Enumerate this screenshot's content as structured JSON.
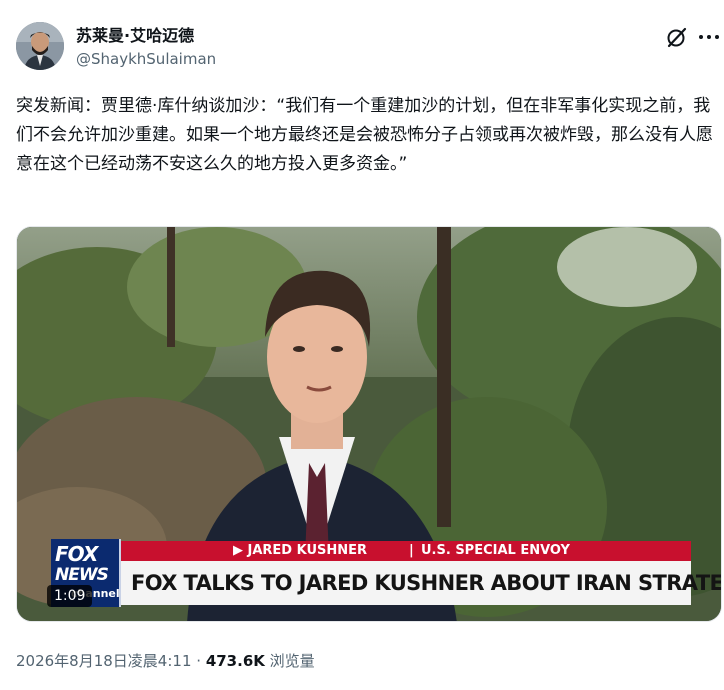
{
  "author": {
    "display_name": "苏莱曼·艾哈迈德",
    "handle": "@ShaykhSulaiman"
  },
  "tweet": {
    "text": "突发新闻：贾里德·库什纳谈加沙：“我们有一个重建加沙的计划，但在非军事化实现之前，我们不会允许加沙重建。如果一个地方最终还是会被恐怖分子占领或再次被炸毁，那么没有人愿意在这个已经动荡不安这么久的地方投入更多资金。”"
  },
  "video": {
    "duration": "1:09",
    "lower_third": {
      "name": "▶ JARED KUSHNER",
      "separator": "|",
      "title": "U.S. SPECIAL ENVOY",
      "headline": "FOX TALKS TO JARED KUSHNER ABOUT IRAN STRATEGY"
    },
    "logo": {
      "line1": "FOX",
      "line2": "NEWS",
      "line3": "channel"
    }
  },
  "meta": {
    "timestamp": "2026年8月18日凌晨4:11",
    "separator": " · ",
    "views_count": "473.6K",
    "views_label": " 浏览量"
  },
  "icons": {
    "grok": "grok-slash-icon",
    "more": "more-dots-icon"
  },
  "colors": {
    "fox_red": "#c8102e",
    "fox_blue": "#0b2a6f",
    "secondary_text": "#536471"
  }
}
